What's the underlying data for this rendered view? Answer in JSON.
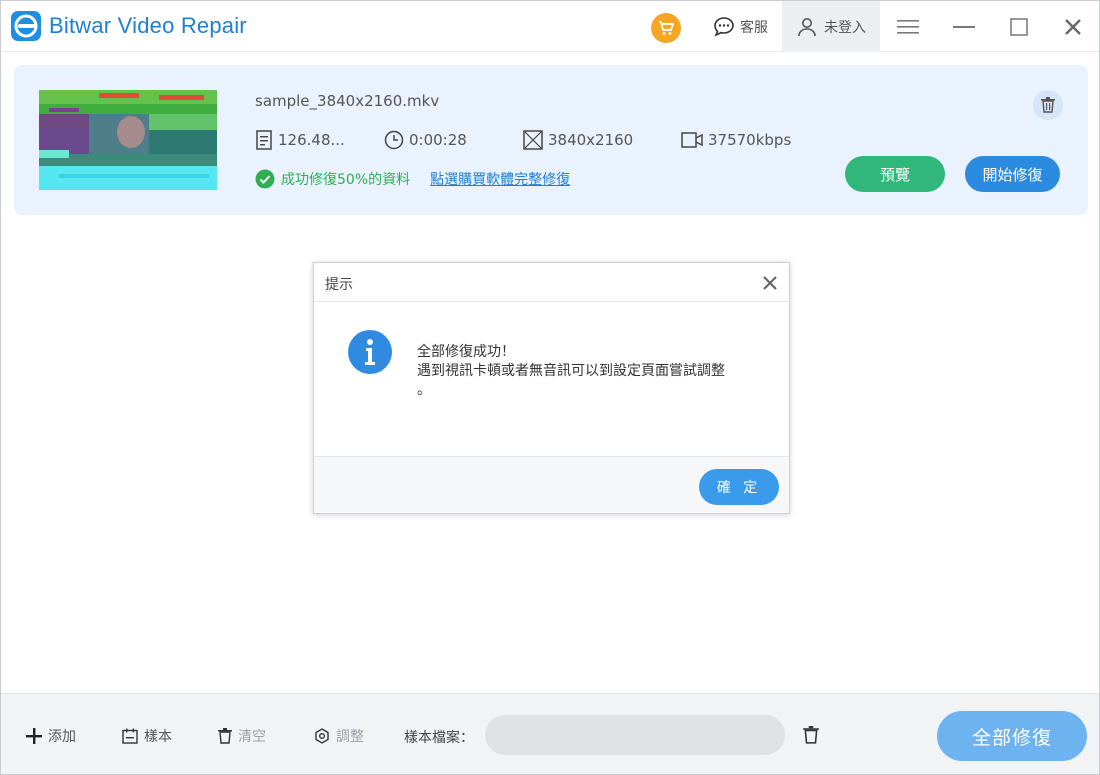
{
  "app": {
    "title": "Bitwar Video Repair",
    "accent": "#1e7fd6"
  },
  "titlebar": {
    "support_label": "客服",
    "login_label": "未登入"
  },
  "file": {
    "name": "sample_3840x2160.mkv",
    "size": "126.48...",
    "duration": "0:00:28",
    "resolution": "3840x2160",
    "bitrate": "37570kbps",
    "status": "成功修復50%的資料",
    "buy_link": "點選購買軟體完整修復",
    "preview_label": "預覽",
    "start_label": "開始修復"
  },
  "dialog": {
    "title": "提示",
    "message_line1": "全部修復成功！",
    "message_line2": "遇到視訊卡頓或者無音訊可以到設定頁面嘗試調整",
    "message_line3": "。",
    "ok_label": "確 定"
  },
  "toolbar": {
    "add_label": "添加",
    "sample_label": "樣本",
    "clear_label": "清空",
    "adjust_label": "調整",
    "sample_file_label": "樣本檔案：",
    "sample_file_value": "",
    "repair_all_label": "全部修復"
  },
  "colors": {
    "preview_button": "#31b77a",
    "start_button": "#2b8be0",
    "repair_all_button": "#6cb3ef",
    "success_text": "#2eaf52",
    "cart_badge": "#f5a623"
  }
}
